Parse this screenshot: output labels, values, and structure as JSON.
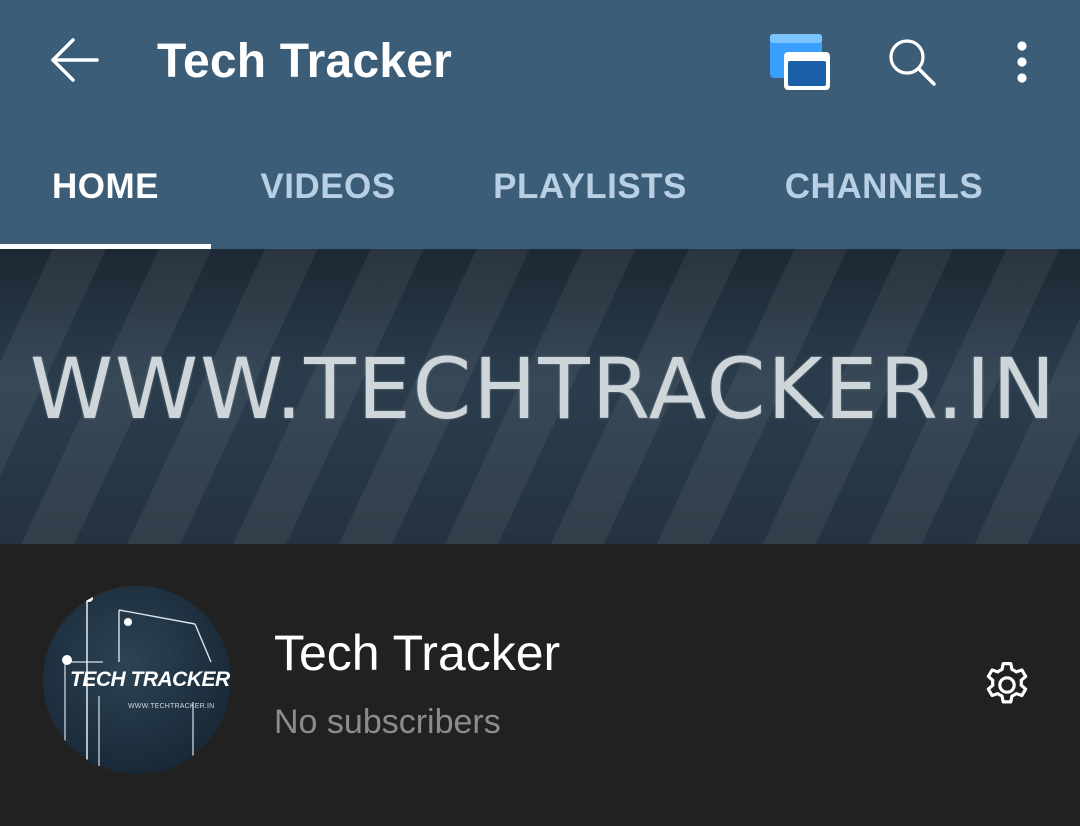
{
  "app_bar": {
    "title": "Tech Tracker",
    "back_icon": "arrow-left-icon",
    "miniplayer_icon": "picture-in-picture-icon",
    "search_icon": "search-icon",
    "more_icon": "more-vertical-icon",
    "background": "#3b5d78"
  },
  "tabs": [
    {
      "label": "HOME",
      "active": true
    },
    {
      "label": "VIDEOS",
      "active": false
    },
    {
      "label": "PLAYLISTS",
      "active": false
    },
    {
      "label": "CHANNELS",
      "active": false
    }
  ],
  "banner": {
    "text": "WWW.TECHTRACKER.IN"
  },
  "channel": {
    "name": "Tech Tracker",
    "subscribers": "No subscribers",
    "avatar_logo_text": "TECH TRACKER",
    "avatar_small_text": "WWW.TECHTRACKER.IN",
    "settings_icon": "gear-icon"
  },
  "colors": {
    "accent_blue": "#2f8fe0",
    "tab_inactive": "#b9d0e4",
    "background_dark": "#212121"
  }
}
